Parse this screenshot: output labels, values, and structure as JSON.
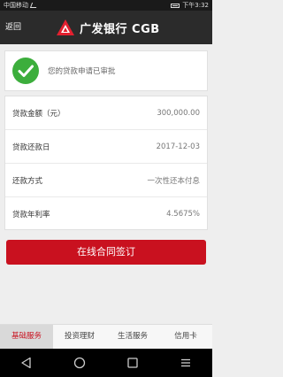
{
  "status_bar": {
    "carrier": "中国移动",
    "time": "下午3:32"
  },
  "header": {
    "back_label": "返回",
    "bank_name": "广发银行 CGB"
  },
  "status_card": {
    "message": "您的贷款申请已审批"
  },
  "loan_info": [
    {
      "label": "贷款金额（元）",
      "value": "300,000.00"
    },
    {
      "label": "贷款还款日",
      "value": "2017-12-03"
    },
    {
      "label": "还款方式",
      "value": "一次性还本付息"
    },
    {
      "label": "贷款年利率",
      "value": "4.5675%"
    }
  ],
  "sign_button": {
    "label": "在线合同签订"
  },
  "tabs": [
    {
      "label": "基础服务"
    },
    {
      "label": "投资理财"
    },
    {
      "label": "生活服务"
    },
    {
      "label": "信用卡"
    }
  ],
  "colors": {
    "brand_red": "#c9111f",
    "check_green": "#3cae3c",
    "header_bg": "#2b2b2b"
  },
  "icons": [
    "back-icon",
    "home-icon",
    "recent-apps-icon",
    "menu-icon",
    "check-icon",
    "cgb-logo-icon"
  ]
}
